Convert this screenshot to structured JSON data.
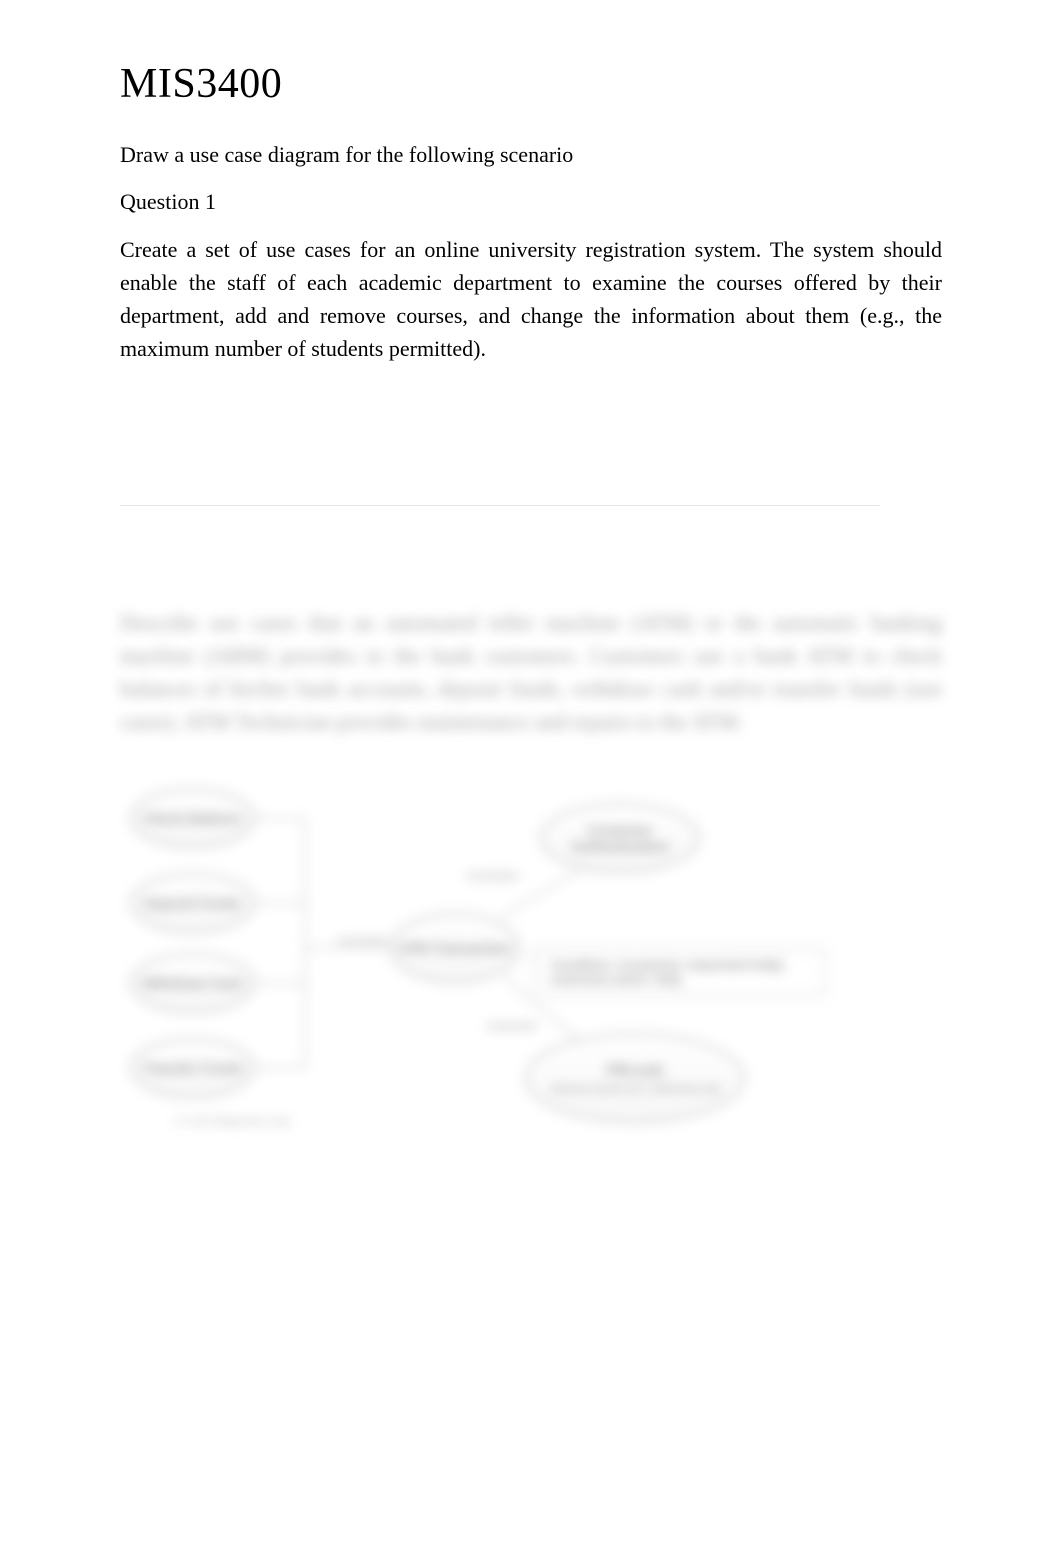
{
  "header": {
    "title": "MIS3400"
  },
  "instruction": "Draw a use case diagram for the following scenario",
  "question_label": "Question 1",
  "question_body": "Create a set of use cases for an online university registration system. The system should enable the staff of each academic department to examine the courses offered by their department, add and remove courses, and change the information about them (e.g., the maximum number of students permitted).",
  "blurred": {
    "paragraph": "Describe use cases that an automated teller machine (ATM) or the automatic banking machine (ABM) provides to the bank customers. Customers use a bank ATM to check balances of his/her bank accounts, deposit funds, withdraw cash and/or transfer funds (use cases). ATM Technician provides maintenance and repairs to the ATM.",
    "diagram": {
      "ellipses": {
        "check_balance": "Check Balance",
        "deposit_funds": "Deposit Funds",
        "withdraw_cash": "Withdraw Cash",
        "transfer_funds": "Transfer Funds",
        "atm_transaction": "ATM Transaction",
        "customer_authentication": "Customer Authentication",
        "pin_sub": "advance-quota w/3 i deficiency-tag"
      },
      "pin_title": "PIN-sub",
      "labels": {
        "include": "«include»",
        "extend": "«extend»"
      },
      "note": "Condition: {customer requested help} extension point: Help",
      "caption": "© uml-diagrams.org"
    }
  }
}
